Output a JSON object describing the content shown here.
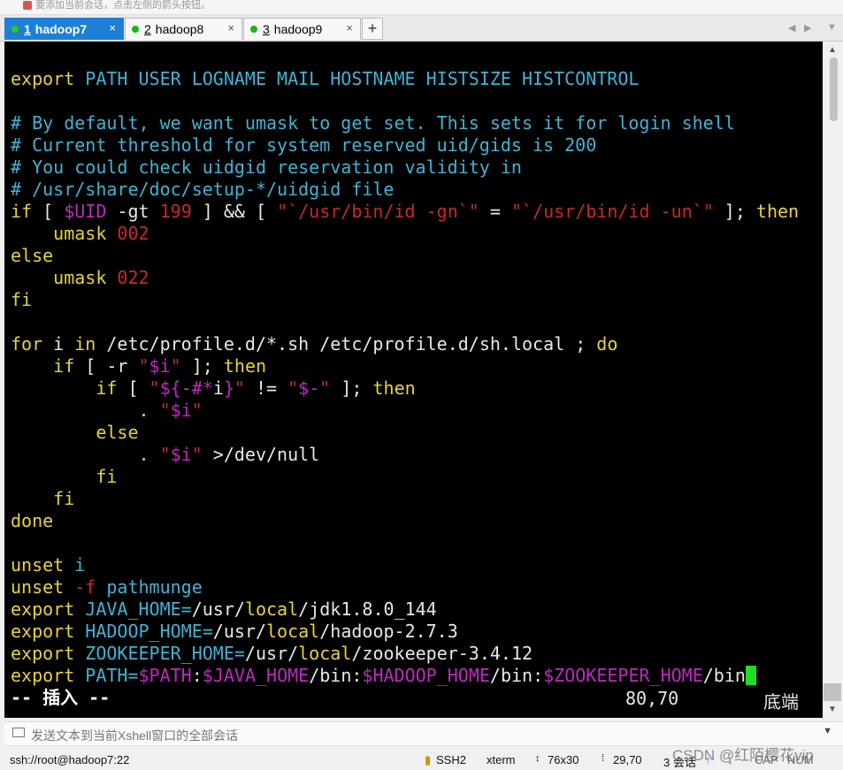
{
  "top_hint": "要添加当前会话，点击左侧的箭头按钮。",
  "tabs": [
    {
      "num": "1",
      "label": "hadoop7",
      "active": true
    },
    {
      "num": "2",
      "label": "hadoop8",
      "active": false
    },
    {
      "num": "3",
      "label": "hadoop9",
      "active": false
    }
  ],
  "tab_close": "×",
  "add_tab": "+",
  "nav_prev": "◀",
  "nav_next": "▶",
  "nav_menu": "▼",
  "terminal": {
    "mode": "-- 插入 --",
    "position": "80,70",
    "scroll_state": "底端"
  },
  "input_bar": {
    "placeholder": "发送文本到当前Xshell窗口的全部会话"
  },
  "statusbar": {
    "connection": "ssh://root@hadoop7:22",
    "protocol": "SSH2",
    "terminal_type": "xterm",
    "size": "76x30",
    "cursor": "29,70",
    "sessions": "3 会话",
    "caps": "CAP",
    "num": "NUM"
  },
  "watermark": "CSDN @红陌樱花vip"
}
